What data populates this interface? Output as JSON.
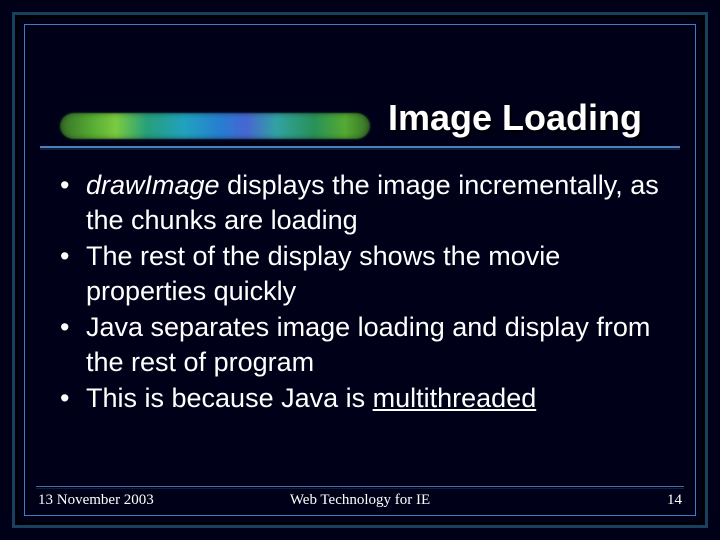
{
  "slide": {
    "title": "Image Loading",
    "bullets": [
      {
        "html": "<span class='em'>drawImage</span> displays the image incrementally, as the chunks are loading"
      },
      {
        "html": "The rest of the display shows the movie properties quickly"
      },
      {
        "html": "Java separates image loading and display from the rest of program"
      },
      {
        "html": "This is because Java is <span class='ul'>multithreaded</span>"
      }
    ]
  },
  "footer": {
    "date": "13 November 2003",
    "center": "Web Technology for IE",
    "page": "14"
  }
}
